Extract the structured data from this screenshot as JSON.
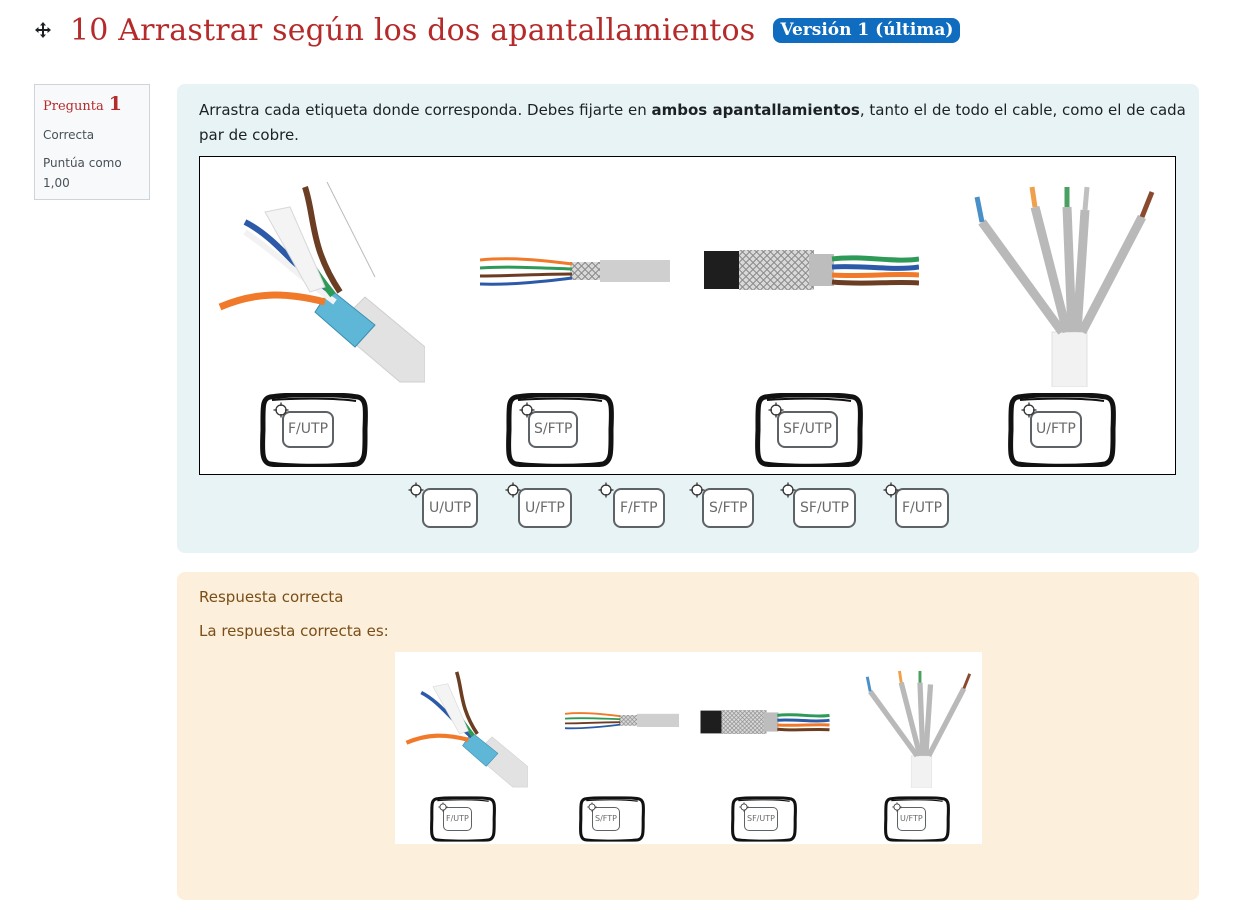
{
  "page": {
    "title": "10 Arrastrar según los dos apantallamientos",
    "version_badge": "Versión 1 (última)"
  },
  "question_info": {
    "label": "Pregunta",
    "number": "1",
    "state": "Correcta",
    "grade_line1": "Puntúa como",
    "grade_line2": "1,00"
  },
  "question": {
    "prompt_before": " Arrastra cada etiqueta donde corresponda. Debes fijarte en ",
    "prompt_bold": "ambos apantallamientos",
    "prompt_after": ", tanto el de todo el cable, como el de cada par de cobre.",
    "dropped": [
      "F/UTP",
      "S/FTP",
      "SF/UTP",
      "U/FTP"
    ],
    "drag_items": [
      "U/UTP",
      "U/FTP",
      "F/FTP",
      "S/FTP",
      "SF/UTP",
      "F/UTP"
    ]
  },
  "feedback": {
    "status": "Respuesta correcta",
    "right_answer_label": "La respuesta correcta es:",
    "answer_labels": [
      "F/UTP",
      "S/FTP",
      "SF/UTP",
      "U/FTP"
    ]
  },
  "colors": {
    "title": "#b52a2a",
    "badge": "#0f6cbf",
    "question_bg": "#e7f3f5",
    "feedback_bg": "#fcefdc",
    "feedback_text": "#7a4e16"
  },
  "icons": [
    "move-icon",
    "target-icon"
  ]
}
